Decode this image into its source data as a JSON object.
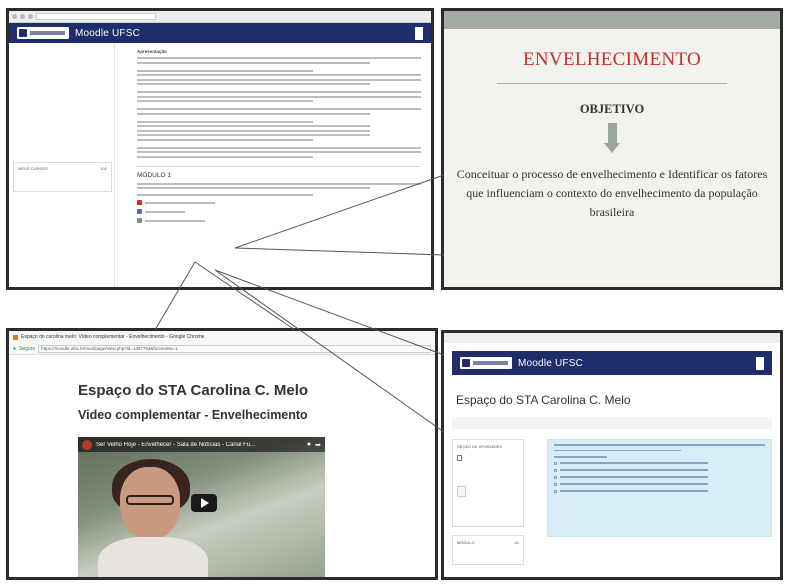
{
  "moodle": {
    "brand": "Moodle UFSC",
    "block_title": "MEUS CURSOS",
    "block_id": "102",
    "module_title": "MÓDULO 1",
    "intro_label": "Apresentação"
  },
  "slide": {
    "title": "ENVELHECIMENTO",
    "objective_label": "OBJETIVO",
    "text": "Conceituar o processo de envelhecimento e Identificar os fatores que influenciam o contexto do envelhecimento da população brasileira"
  },
  "video_page": {
    "window_title": "Espaço do carolina melo: Vídeo complementar - Envelhecimento - Google Chrome",
    "secure_label": "Seguro",
    "url": "https://moodle.ufsc.br/mod/page/view.php?id=1397784&forceview=1",
    "heading": "Espaço do STA Carolina C. Melo",
    "subheading": "Video complementar - Envelhecimento",
    "video_title": "Ser Velho Hoje - Envelhecer - Sala de Notícias - Canal Fu..."
  },
  "space_page": {
    "brand": "Moodle UFSC",
    "title": "Espaço do STA Carolina C. Melo",
    "block_title": "SEÇÃO DE ATIVIDADES",
    "block2_title": "MÓDULO",
    "block2_id": "01"
  },
  "colors": {
    "moodle_nav": "#1f2d6b",
    "slide_title": "#c3302b",
    "slide_arrow": "#99a69e",
    "info_box": "#d9edf7"
  }
}
